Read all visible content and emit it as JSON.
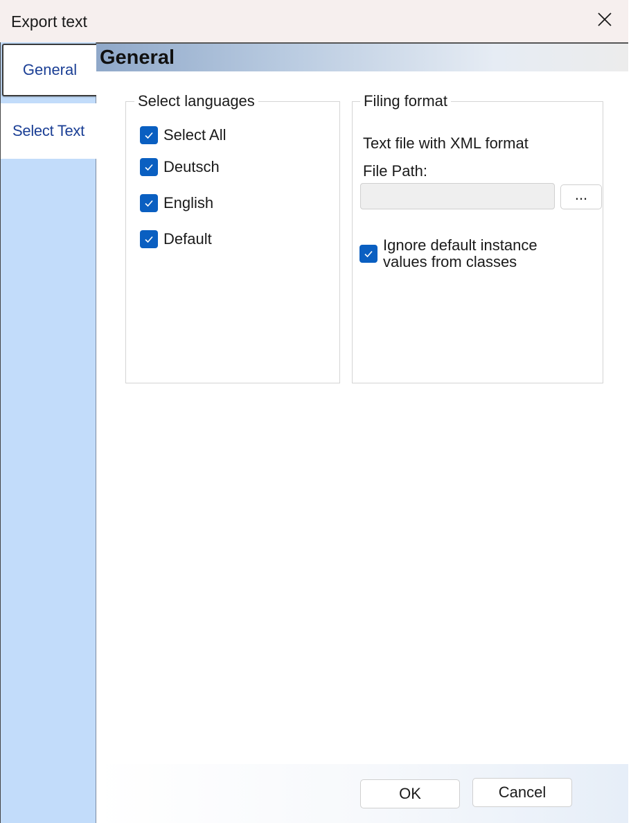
{
  "window": {
    "title": "Export text"
  },
  "sidebar": {
    "tabs": [
      {
        "label": "General",
        "selected": true
      },
      {
        "label": "Select Text",
        "selected": false
      }
    ]
  },
  "main": {
    "section_title": "General",
    "languages": {
      "legend": "Select languages",
      "items": [
        {
          "label": "Select All",
          "checked": true
        },
        {
          "label": "Deutsch",
          "checked": true
        },
        {
          "label": "English",
          "checked": true
        },
        {
          "label": "Default",
          "checked": true
        }
      ]
    },
    "filing": {
      "legend": "Filing format",
      "format_text": "Text file with XML format",
      "file_path_label": "File Path:",
      "file_path_value": "",
      "browse_label": "...",
      "ignore_label": "Ignore default instance values from classes",
      "ignore_checked": true
    }
  },
  "footer": {
    "ok_label": "OK",
    "cancel_label": "Cancel"
  },
  "colors": {
    "checkbox_accent": "#0a5fc1",
    "sidebar_bg": "#c2dcfa",
    "tab_text": "#1b3f95"
  },
  "icons": {
    "close": "close-icon",
    "check": "checkmark-icon"
  }
}
